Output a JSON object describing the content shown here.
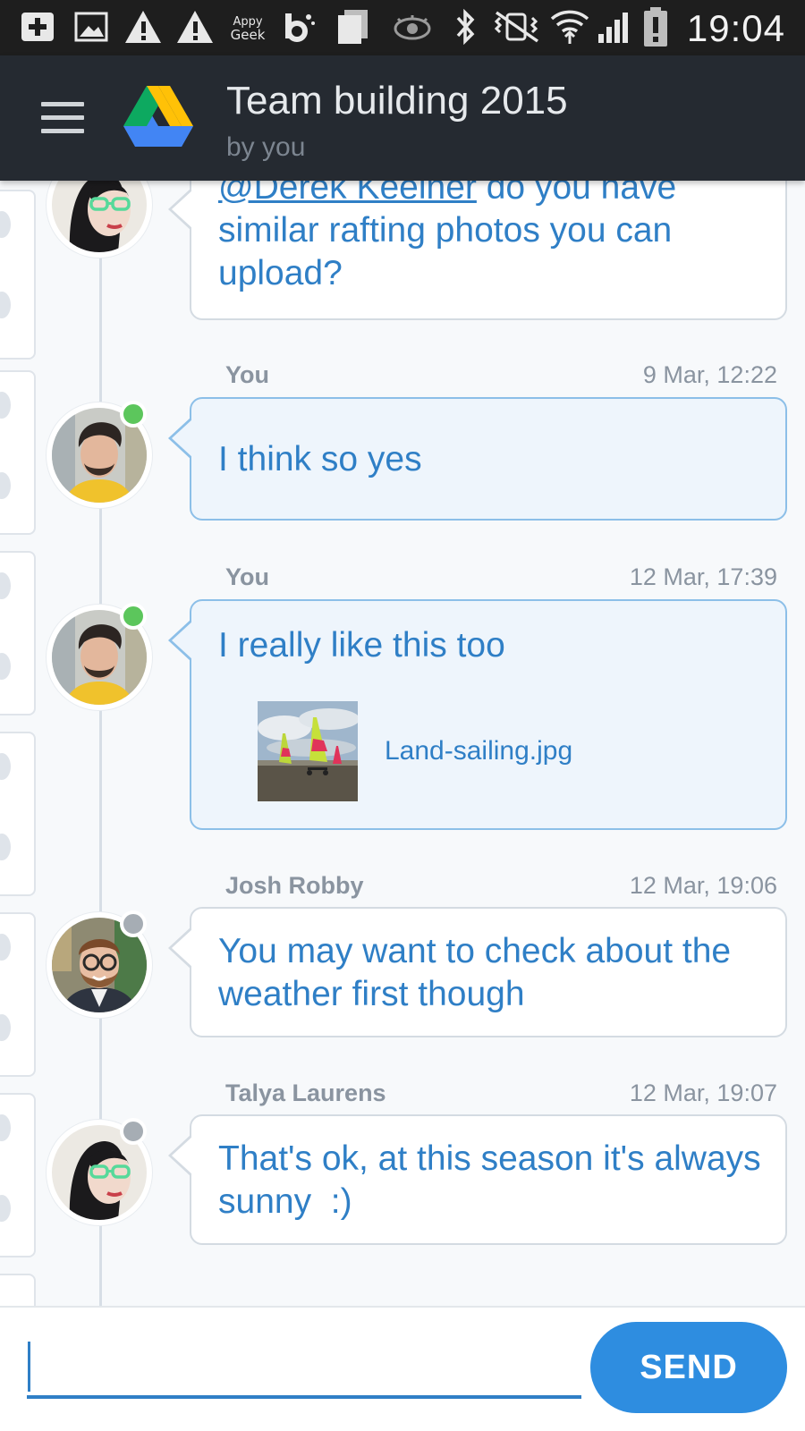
{
  "status_bar": {
    "time": "19:04",
    "app_label": "Appy Geek",
    "icons": [
      "add-notification-icon",
      "image-notification-icon",
      "warning-icon",
      "warning-icon",
      "appy-geek-icon",
      "beats-icon",
      "clipboard-icon",
      "eye-icon",
      "bluetooth-icon",
      "vibrate-icon",
      "wifi-icon",
      "signal-icon",
      "battery-alert-icon"
    ]
  },
  "header": {
    "title": "Team building 2015",
    "subtitle": "by you",
    "brand_colors": {
      "green": "#0da960",
      "yellow": "#ffc107",
      "blue": "#4285f4"
    }
  },
  "messages": [
    {
      "author": "",
      "time": "",
      "mention": "@Derek Keelner",
      "text_after_mention": " do you have similar rafting photos you can upload?",
      "avatar": "talya-laurens-avatar",
      "mine": false
    },
    {
      "author": "You",
      "time": "9 Mar, 12:22",
      "text": "I think so yes",
      "avatar": "you-avatar",
      "online": true,
      "mine": true
    },
    {
      "author": "You",
      "time": "12 Mar, 17:39",
      "text": "I really like this too",
      "attachment": {
        "file_name": "Land-sailing.jpg"
      },
      "avatar": "you-avatar",
      "online": true,
      "mine": true
    },
    {
      "author": "Josh Robby",
      "time": "12 Mar, 19:06",
      "text": "You may want to check about the weather first though",
      "avatar": "josh-robby-avatar",
      "online": false,
      "mine": false
    },
    {
      "author": "Talya Laurens",
      "time": "12 Mar, 19:07",
      "text": "That's ok, at this season it's always sunny  :)",
      "avatar": "talya-laurens-avatar",
      "online": false,
      "mine": false
    }
  ],
  "composer": {
    "input_value": "",
    "send_label": "SEND"
  },
  "colors": {
    "accent": "#2f7fc6",
    "send_button": "#2e8de0",
    "online": "#5cc65c",
    "offline": "#a6adb4",
    "app_bar": "#252a31"
  }
}
